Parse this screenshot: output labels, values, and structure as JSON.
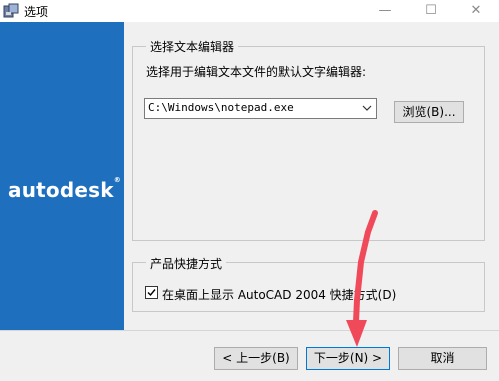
{
  "window": {
    "title": "选项",
    "minimize_glyph": "—",
    "maximize_glyph": "☐",
    "close_glyph": "✕"
  },
  "banner": {
    "brand": "autodesk",
    "brand_mark": "®"
  },
  "editor_group": {
    "legend": "选择文本编辑器",
    "description": "选择用于编辑文本文件的默认文字编辑器:",
    "path_value": "C:\\Windows\\notepad.exe",
    "browse_label": "浏览(B)..."
  },
  "shortcut_group": {
    "legend": "产品快捷方式",
    "checkbox_label": "在桌面上显示 AutoCAD 2004 快捷方式(D)",
    "checked": true
  },
  "footer": {
    "back_label": "< 上一步(B)",
    "next_label": "下一步(N) >",
    "cancel_label": "取消"
  },
  "colors": {
    "banner": "#1f6fbf",
    "annotation_arrow": "#f04a5a",
    "default_button_border": "#0078d7"
  }
}
